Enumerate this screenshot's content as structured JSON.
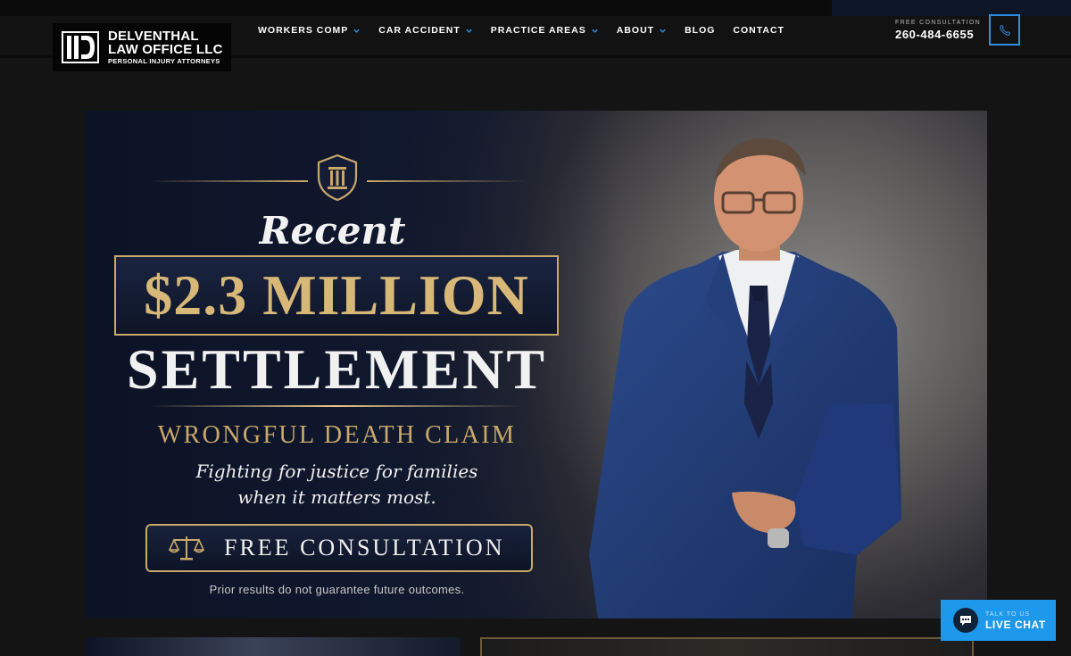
{
  "header": {
    "logo": {
      "line1": "DELVENTHAL",
      "line2": "LAW OFFICE LLC",
      "line3": "PERSONAL INJURY ATTORNEYS"
    },
    "nav": [
      {
        "label": "WORKERS COMP",
        "has_dropdown": true
      },
      {
        "label": "CAR ACCIDENT",
        "has_dropdown": true
      },
      {
        "label": "PRACTICE AREAS",
        "has_dropdown": true
      },
      {
        "label": "ABOUT",
        "has_dropdown": true
      },
      {
        "label": "BLOG",
        "has_dropdown": false
      },
      {
        "label": "CONTACT",
        "has_dropdown": false
      }
    ],
    "consultation_label": "FREE CONSULTATION",
    "phone": "260-484-6655",
    "phone_icon": "phone-icon"
  },
  "hero": {
    "heading_small": "Recent",
    "amount": "$2.3 MILLION",
    "heading_large": "SETTLEMENT",
    "claim": "WRONGFUL DEATH CLAIM",
    "tagline_line1": "Fighting for justice for families",
    "tagline_line2": "when it matters most.",
    "cta_label": "FREE CONSULTATION",
    "cta_icon": "scales-icon",
    "disclaimer": "Prior results do not guarantee future outcomes.",
    "emblem_icon": "pillar-shield-icon"
  },
  "livechat": {
    "top": "TALK TO US",
    "main": "LIVE CHAT",
    "icon": "chat-bubble-icon"
  },
  "colors": {
    "accent_gold": "#c9a86a",
    "accent_blue": "#1e98ea",
    "background": "#141414",
    "hero_navy": "#0e1527"
  }
}
